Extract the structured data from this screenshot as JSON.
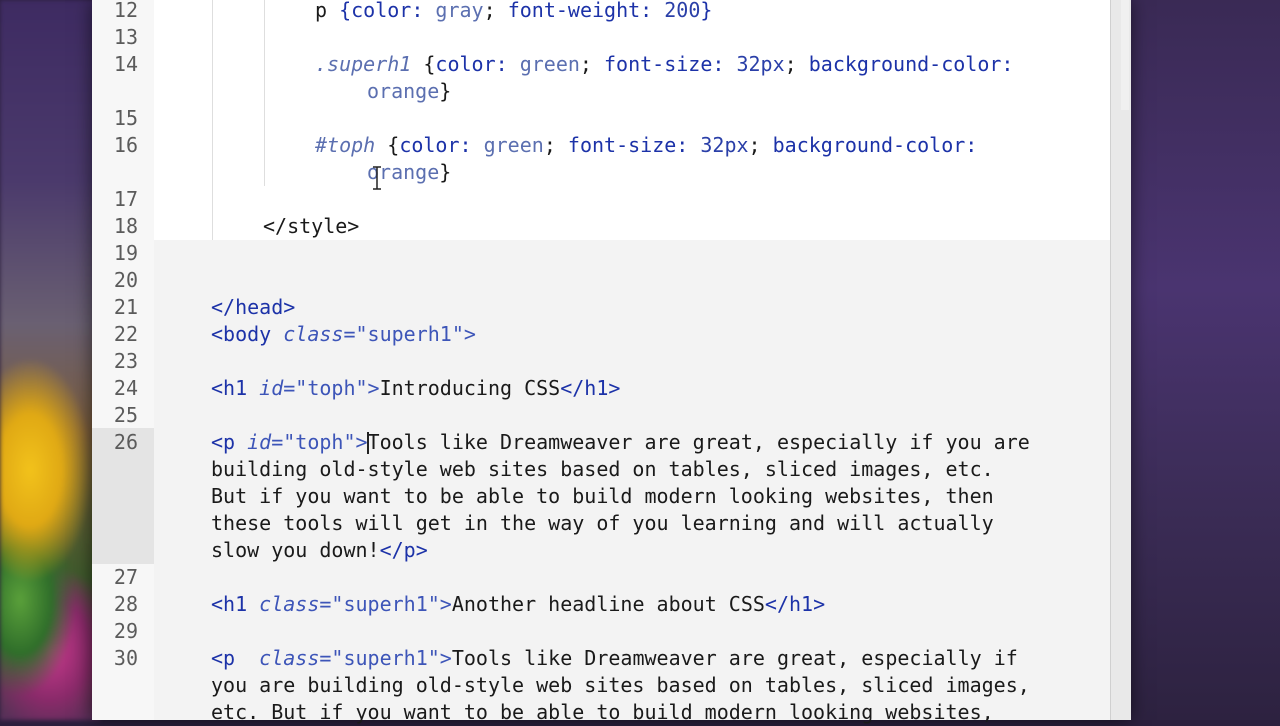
{
  "editor": {
    "line_numbers": [
      "12",
      "13",
      "14",
      "15",
      "16",
      "17",
      "18",
      "19",
      "20",
      "21",
      "22",
      "23",
      "24",
      "25",
      "26",
      "27",
      "28",
      "29",
      "30"
    ],
    "lines": {
      "l12": {
        "p1": "p ",
        "p2": "{color:",
        "p3": " gray",
        "p4": "; ",
        "p5": "font-weight:",
        "p6": " 200",
        "p7": "}"
      },
      "l14a": {
        "p1": ".superh1",
        "p2": " {",
        "p3": "color:",
        "p4": " green",
        "p5": "; ",
        "p6": "font-size:",
        "p7": " 32px",
        "p8": "; ",
        "p9": "background-color:"
      },
      "l14b": {
        "p1": "orange",
        "p2": "}"
      },
      "l16a": {
        "p1": "#toph",
        "p2": " {",
        "p3": "color:",
        "p4": " green",
        "p5": "; ",
        "p6": "font-size:",
        "p7": " 32px",
        "p8": "; ",
        "p9": "background-color:"
      },
      "l16b": {
        "p1": "orange",
        "p2": "}"
      },
      "l18": {
        "p1": "</style>"
      },
      "l21": {
        "p1": "</head>"
      },
      "l22": {
        "p1": "<body ",
        "p2": "class",
        "p3": "=\"superh1\">"
      },
      "l24": {
        "p1": "<h1 ",
        "p2": "id",
        "p3": "=\"toph\">",
        "p4": "Introducing CSS",
        "p5": "</h1>"
      },
      "l26a": {
        "p1": "<p ",
        "p2": "id",
        "p3": "=\"toph\">",
        "p4": "Tools like Dreamweaver are great, especially if you are"
      },
      "l26b": {
        "p1": "building old-style web sites based on tables, sliced images, etc."
      },
      "l26c": {
        "p1": "But if you want to be able to build modern looking websites, then"
      },
      "l26d": {
        "p1": "these tools will get in the way of you learning and will actually"
      },
      "l26e": {
        "p1": "slow you down!",
        "p2": "</p>"
      },
      "l28": {
        "p1": "<h1 ",
        "p2": "class",
        "p3": "=\"superh1\">",
        "p4": "Another headline about CSS",
        "p5": "</h1>"
      },
      "l30a": {
        "p1": "<p  ",
        "p2": "class",
        "p3": "=\"superh1\">",
        "p4": "Tools like Dreamweaver are great, especially if"
      },
      "l30b": {
        "p1": "you are building old-style web sites based on tables, sliced images,"
      },
      "l30c": {
        "p1": "etc. But if you want to be able to build modern looking websites,"
      }
    },
    "current_line": "26",
    "colors": {
      "tag": "#1c32a8",
      "attribute": "#3d55b8",
      "text": "#1a1a1a",
      "gutter": "#f7f7f7",
      "background": "#ffffff"
    }
  }
}
